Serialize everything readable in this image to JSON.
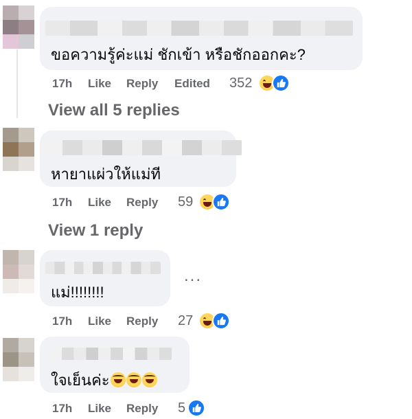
{
  "comments": [
    {
      "text": "ขอความรู้ค่ะแม่ ชักเข้า หรือชักออกคะ?",
      "time": "17h",
      "like_label": "Like",
      "reply_label": "Reply",
      "edited_label": "Edited",
      "reaction_count": "352",
      "reaction_icons": [
        "haha-icon",
        "like-icon"
      ],
      "view_replies": "View all 5 replies"
    },
    {
      "text": "หายาแผ่วให้แม่ที",
      "time": "17h",
      "like_label": "Like",
      "reply_label": "Reply",
      "reaction_count": "59",
      "reaction_icons": [
        "haha-icon",
        "like-icon"
      ],
      "view_replies": "View 1 reply"
    },
    {
      "text": "แม่!!!!!!!!",
      "time": "17h",
      "like_label": "Like",
      "reply_label": "Reply",
      "reaction_count": "27",
      "reaction_icons": [
        "haha-icon",
        "like-icon"
      ],
      "more_label": "..."
    },
    {
      "text": "ใจเย็นค่ะ",
      "text_emoji_count": 3,
      "time": "17h",
      "like_label": "Like",
      "reply_label": "Reply",
      "reaction_count": "5",
      "reaction_icons": [
        "like-icon"
      ]
    }
  ],
  "colors": {
    "bubble": "#f0f2f5",
    "meta_text": "#65676b",
    "like_blue": "#1877f2",
    "haha_yellow": "#f7b125"
  }
}
